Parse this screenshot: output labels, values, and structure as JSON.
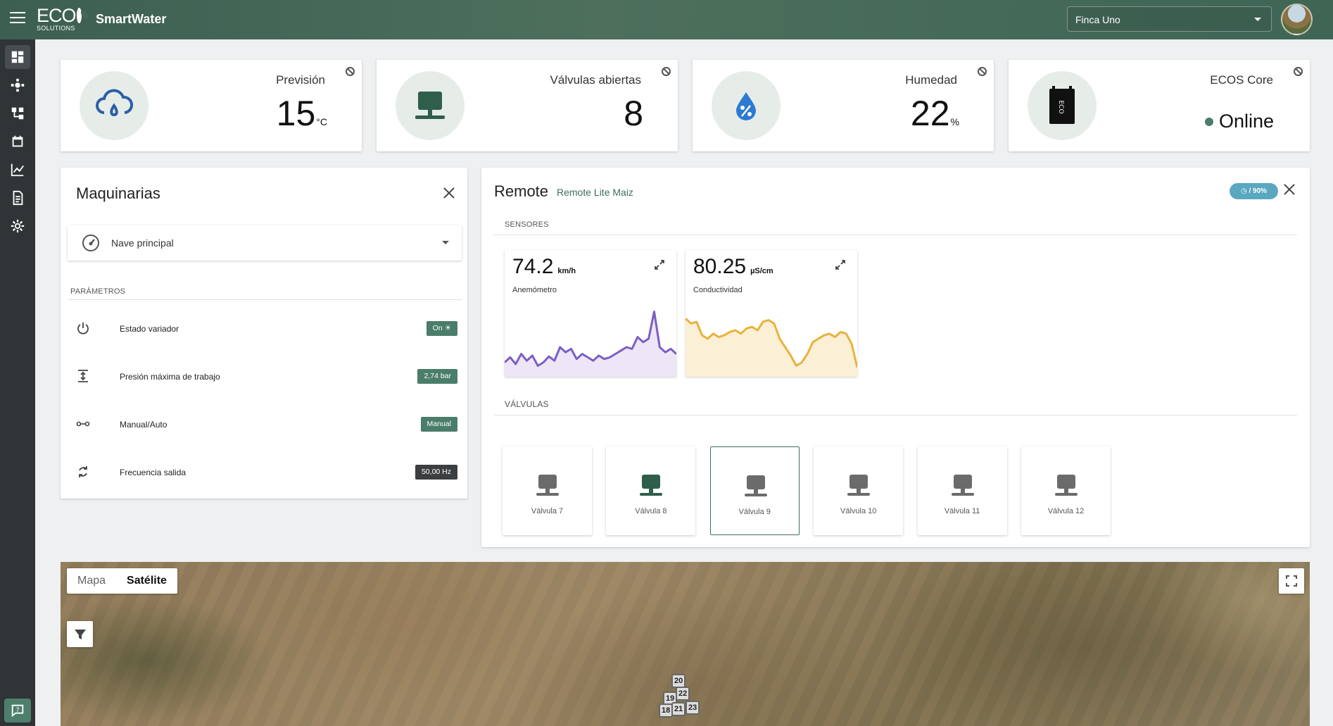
{
  "header": {
    "logo_text": "ECO",
    "logo_subtext": "SOLUTIONS",
    "app_title": "SmartWater",
    "farm": "Finca Uno"
  },
  "sidebar": {
    "items": [
      "dashboard-icon",
      "pump-icon",
      "network-icon",
      "calendar-icon",
      "chart-icon",
      "report-icon",
      "gear-icon"
    ],
    "help_icon": "help-chat-icon"
  },
  "stats": [
    {
      "label": "Previsión",
      "value": "15",
      "unit": "°C",
      "icon": "rain-cloud-icon"
    },
    {
      "label": "Válvulas abiertas",
      "value": "8",
      "unit": "",
      "icon": "valve-icon"
    },
    {
      "label": "Humedad",
      "value": "22",
      "unit": "%",
      "icon": "humidity-drop-icon"
    },
    {
      "label": "ECOS Core",
      "value": "Online",
      "unit": "",
      "icon": "ecos-device-icon"
    }
  ],
  "machinery": {
    "title": "Maquinarias",
    "selected": "Nave principal",
    "section": "Parámetros",
    "params": [
      {
        "name": "Estado variador",
        "value": "On ☀",
        "icon": "power-icon",
        "style": "green"
      },
      {
        "name": "Presión máxima de trabajo",
        "value": "2,74 bar",
        "icon": "pressure-icon",
        "style": "green"
      },
      {
        "name": "Manual/Auto",
        "value": "Manual",
        "icon": "toggle-icon",
        "style": "green"
      },
      {
        "name": "Frecuencia salida",
        "value": "50,00 Hz",
        "icon": "refresh-icon",
        "style": "dark"
      }
    ]
  },
  "remote": {
    "title": "Remote",
    "subtitle": "Remote Lite Maiz",
    "battery": "/ 90%",
    "sensors_label": "Sensores",
    "valves_label": "Válvulas",
    "sensors": [
      {
        "value": "74.2",
        "unit": "km/h",
        "name": "Anemómetro",
        "color": "#7b5fc4",
        "fill": "#ece6f7",
        "points": [
          12,
          18,
          10,
          22,
          14,
          20,
          8,
          12,
          19,
          14,
          30,
          24,
          28,
          16,
          22,
          18,
          14,
          20,
          16,
          18,
          22,
          26,
          30,
          28,
          42,
          36,
          40,
          72,
          30,
          24,
          28,
          22
        ]
      },
      {
        "value": "80.25",
        "unit": "µS/cm",
        "name": "Conductividad",
        "color": "#e8b23c",
        "fill": "#fbf0d6",
        "points": [
          64,
          58,
          60,
          44,
          40,
          46,
          42,
          44,
          48,
          50,
          46,
          52,
          54,
          50,
          60,
          62,
          58,
          40,
          30,
          20,
          8,
          12,
          22,
          36,
          40,
          44,
          46,
          42,
          48,
          46,
          34,
          6
        ]
      }
    ],
    "valves": [
      {
        "name": "Válvula 7",
        "state": "closed"
      },
      {
        "name": "Válvula 8",
        "state": "open"
      },
      {
        "name": "Válvula 9",
        "state": "selected"
      },
      {
        "name": "Válvula 10",
        "state": "closed"
      },
      {
        "name": "Válvula 11",
        "state": "closed"
      },
      {
        "name": "Válvula 12",
        "state": "closed"
      }
    ],
    "colors": {
      "open": "#2f5e4b",
      "closed": "#6b6b6b"
    }
  },
  "map": {
    "type_map": "Mapa",
    "type_satellite": "Satélite",
    "markers": [
      "20",
      "22",
      "19",
      "21",
      "23",
      "18"
    ]
  }
}
